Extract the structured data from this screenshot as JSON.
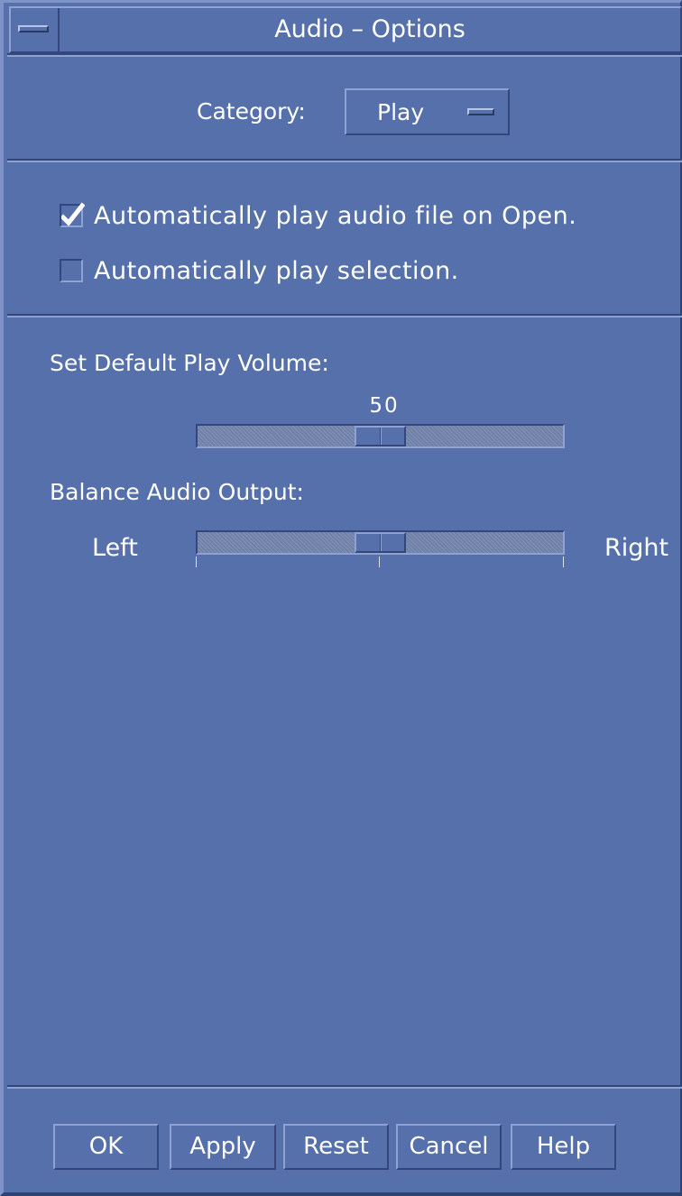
{
  "window": {
    "title": "Audio – Options"
  },
  "category": {
    "label": "Category:",
    "selected": "Play"
  },
  "options": {
    "auto_play_on_open": {
      "label": "Automatically play audio file on Open.",
      "checked": true
    },
    "auto_play_selection": {
      "label": "Automatically play selection.",
      "checked": false
    }
  },
  "volume": {
    "label": "Set Default Play Volume:",
    "value": "50",
    "fraction": 0.5
  },
  "balance": {
    "label": "Balance Audio Output:",
    "left_label": "Left",
    "right_label": "Right",
    "fraction": 0.5
  },
  "buttons": {
    "ok": "OK",
    "apply": "Apply",
    "reset": "Reset",
    "cancel": "Cancel",
    "help": "Help"
  },
  "colors": {
    "background": "#5670ab",
    "text": "#ffffff"
  },
  "icons": {
    "window_menu": "window-menu-icon",
    "option_indicator": "option-menu-indicator-icon",
    "check": "checkmark-icon"
  }
}
